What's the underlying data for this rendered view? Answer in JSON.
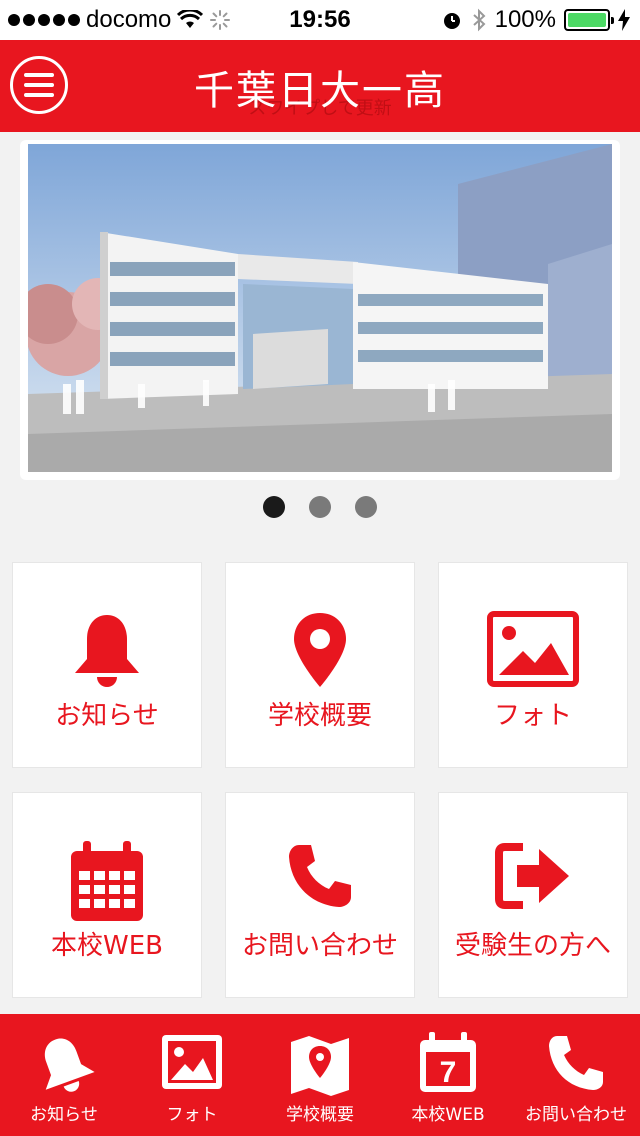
{
  "status_bar": {
    "carrier": "docomo",
    "time": "19:56",
    "battery": "100%"
  },
  "header": {
    "title": "千葉日大一高",
    "subtitle": "スワイプして更新"
  },
  "slider": {
    "page_count": 3,
    "active_index": 0
  },
  "tiles": [
    {
      "label": "お知らせ",
      "icon": "bell-icon"
    },
    {
      "label": "学校概要",
      "icon": "map-pin-icon"
    },
    {
      "label": "フォト",
      "icon": "photo-icon"
    },
    {
      "label": "本校WEB",
      "icon": "calendar-icon"
    },
    {
      "label": "お問い合わせ",
      "icon": "phone-icon"
    },
    {
      "label": "受験生の方へ",
      "icon": "exit-arrow-icon"
    }
  ],
  "tabbar": [
    {
      "label": "お知らせ",
      "icon": "bell-icon"
    },
    {
      "label": "フォト",
      "icon": "photo-icon"
    },
    {
      "label": "学校概要",
      "icon": "map-icon"
    },
    {
      "label": "本校WEB",
      "icon": "calendar-icon"
    },
    {
      "label": "お問い合わせ",
      "icon": "phone-icon"
    }
  ],
  "colors": {
    "brand": "#e8161f",
    "background": "#f2f2f2"
  }
}
